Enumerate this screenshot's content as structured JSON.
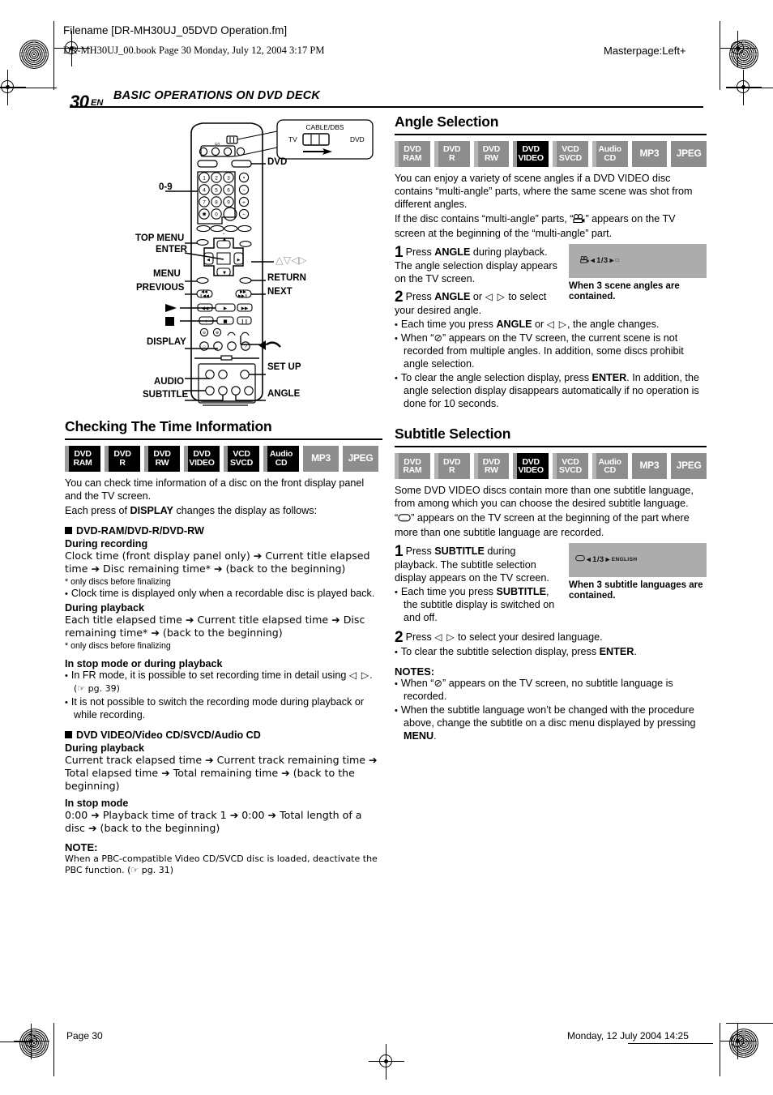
{
  "header": {
    "filename": "Filename [DR-MH30UJ_05DVD Operation.fm]",
    "bookline": "DR-MH30UJ_00.book  Page 30  Monday, July 12, 2004  3:17 PM",
    "masterpage": "Masterpage:Left+",
    "page_number": "30",
    "lang_code": "EN",
    "chapter_title": "BASIC OPERATIONS ON DVD DECK"
  },
  "remote": {
    "switch_callout": {
      "title": "CABLE/DBS",
      "left": "TV",
      "right": "DVD"
    },
    "labels_left": [
      "0-9",
      "TOP MENU",
      "ENTER",
      "MENU",
      "PREVIOUS",
      "DISPLAY",
      "AUDIO",
      "SUBTITLE"
    ],
    "labels_right": [
      "DVD",
      "RETURN",
      "NEXT",
      "SET UP",
      "ANGLE"
    ],
    "label_dvd": "DVD",
    "label_0_9": "0-9",
    "label_top_menu": "TOP MENU",
    "label_enter": "ENTER",
    "label_menu": "MENU",
    "label_previous": "PREVIOUS",
    "label_display": "DISPLAY",
    "label_audio": "AUDIO",
    "label_subtitle": "SUBTITLE",
    "label_return": "RETURN",
    "label_next": "NEXT",
    "label_setup": "SET UP",
    "label_angle": "ANGLE",
    "label_arrows": "△▽◁▷",
    "keypad_digits": [
      "1",
      "2",
      "3",
      "4",
      "5",
      "6",
      "7",
      "8",
      "9",
      "0"
    ]
  },
  "sections": {
    "time_info": {
      "heading": "Checking The Time Information",
      "badges": [
        {
          "l1": "DVD",
          "l2": "RAM",
          "state": "on"
        },
        {
          "l1": "DVD",
          "l2": "R",
          "state": "on"
        },
        {
          "l1": "DVD",
          "l2": "RW",
          "state": "on"
        },
        {
          "l1": "DVD",
          "l2": "VIDEO",
          "state": "on"
        },
        {
          "l1": "VCD",
          "l2": "SVCD",
          "state": "on"
        },
        {
          "l1": "Audio",
          "l2": "CD",
          "state": "on"
        },
        {
          "l1": "MP3",
          "l2": "",
          "state": "off"
        },
        {
          "l1": "JPEG",
          "l2": "",
          "state": "off"
        }
      ],
      "intro1": "You can check time information of a disc on the front display panel and the TV screen.",
      "intro2_a": "Each press of ",
      "intro2_b": "DISPLAY",
      "intro2_c": " changes the display as follows:",
      "sub1_title": "DVD-RAM/DVD-R/DVD-RW",
      "sub1_rec_head": "During recording",
      "sub1_rec_body": "Clock time (front display panel only) ➔ Current title elapsed time ➔ Disc remaining time* ➔ (back to the beginning)",
      "sub1_rec_foot": "*  only discs before finalizing",
      "sub1_rec_bullet": "Clock time is displayed only when a recordable disc is played back.",
      "sub1_play_head": "During playback",
      "sub1_play_body": "Each title elapsed time ➔ Current title elapsed time ➔ Disc remaining time* ➔ (back to the beginning)",
      "sub1_play_foot": "*  only discs before finalizing",
      "sub1_stop_head": "In stop mode or during playback",
      "sub1_stop_b1_a": "In FR mode, it is possible to set recording time in detail using ",
      "sub1_stop_b1_b": "◁ ▷",
      "sub1_stop_b1_c": ". (☞ pg. 39)",
      "sub1_stop_b2": "It is not possible to switch the recording mode during playback or while recording.",
      "sub2_title": "DVD VIDEO/Video CD/SVCD/Audio CD",
      "sub2_play_head": "During playback",
      "sub2_play_body": "Current track elapsed time ➔ Current track remaining time ➔ Total elapsed time ➔ Total remaining time ➔ (back to the beginning)",
      "sub2_stop_head": "In stop mode",
      "sub2_stop_body": "0:00 ➔ Playback time of track 1 ➔ 0:00 ➔ Total length of a disc ➔ (back to the beginning)",
      "note_head": "NOTE:",
      "note_body": "When a PBC-compatible Video CD/SVCD disc is loaded, deactivate the PBC function. (☞ pg. 31)"
    },
    "angle": {
      "heading": "Angle Selection",
      "badges": [
        {
          "l1": "DVD",
          "l2": "RAM",
          "state": "off"
        },
        {
          "l1": "DVD",
          "l2": "R",
          "state": "off"
        },
        {
          "l1": "DVD",
          "l2": "RW",
          "state": "off"
        },
        {
          "l1": "DVD",
          "l2": "VIDEO",
          "state": "on"
        },
        {
          "l1": "VCD",
          "l2": "SVCD",
          "state": "off"
        },
        {
          "l1": "Audio",
          "l2": "CD",
          "state": "off"
        },
        {
          "l1": "MP3",
          "l2": "",
          "state": "off"
        },
        {
          "l1": "JPEG",
          "l2": "",
          "state": "off"
        }
      ],
      "intro1": "You can enjoy a variety of scene angles if a DVD VIDEO disc contains “multi-angle” parts, where the same scene was shot from different angles.",
      "intro2_a": "If the disc contains “multi-angle” parts, “",
      "intro2_c": "” appears on the TV screen at the beginning of the “multi-angle” part.",
      "step1_num": "1",
      "step1_a": "Press ",
      "step1_b": "ANGLE",
      "step1_c": " during playback. The angle selection display appears on the TV screen.",
      "figure_osd": "1/3",
      "figure_caption": "When 3 scene angles are contained.",
      "step2_num": "2",
      "step2_a": "Press ",
      "step2_b": "ANGLE",
      "step2_c": " or ",
      "step2_d": "◁ ▷",
      "step2_e": " to select your desired angle.",
      "b1_a": "Each time you press ",
      "b1_b": "ANGLE",
      "b1_c": " or ",
      "b1_d": "◁ ▷",
      "b1_e": ", the angle changes.",
      "b2": "When “⊘” appears on the TV screen, the current scene is not recorded from multiple angles. In addition, some discs prohibit angle selection.",
      "b3_a": "To clear the angle selection display, press ",
      "b3_b": "ENTER",
      "b3_c": ". In addition, the angle selection display disappears automatically if no operation is done for 10 seconds."
    },
    "subtitle": {
      "heading": "Subtitle Selection",
      "badges": [
        {
          "l1": "DVD",
          "l2": "RAM",
          "state": "off"
        },
        {
          "l1": "DVD",
          "l2": "R",
          "state": "off"
        },
        {
          "l1": "DVD",
          "l2": "RW",
          "state": "off"
        },
        {
          "l1": "DVD",
          "l2": "VIDEO",
          "state": "on"
        },
        {
          "l1": "VCD",
          "l2": "SVCD",
          "state": "off"
        },
        {
          "l1": "Audio",
          "l2": "CD",
          "state": "off"
        },
        {
          "l1": "MP3",
          "l2": "",
          "state": "off"
        },
        {
          "l1": "JPEG",
          "l2": "",
          "state": "off"
        }
      ],
      "intro1": "Some DVD VIDEO discs contain more than one subtitle language, from among which you can choose the desired subtitle language.",
      "intro2_a": "“",
      "intro2_c": "” appears on the TV screen at the beginning of the part where more than one subtitle language are recorded.",
      "step1_num": "1",
      "step1_a": "Press ",
      "step1_b": "SUBTITLE",
      "step1_c": " during playback. The subtitle selection display appears on the TV screen.",
      "figure_osd": "1/3",
      "figure_osd_lang": "ENGLISH",
      "figure_caption": "When 3 subtitle languages are contained.",
      "b1_a": "Each time you press ",
      "b1_b": "SUBTITLE",
      "b1_c": ", the subtitle display is switched on and off.",
      "step2_num": "2",
      "step2_a": "Press ",
      "step2_d": "◁ ▷",
      "step2_e": " to select your desired language.",
      "b2_a": "To clear the subtitle selection display, press ",
      "b2_b": "ENTER",
      "b2_c": ".",
      "notes_head": "NOTES:",
      "n1": "When “⊘” appears on the TV screen, no subtitle language is recorded.",
      "n2_a": "When the subtitle language won’t be changed with the procedure above, change the subtitle on a disc menu displayed by pressing ",
      "n2_b": "MENU",
      "n2_c": "."
    }
  },
  "footer": {
    "page_label": "Page 30",
    "date_label": "Monday, 12 July 2004  14:25"
  }
}
